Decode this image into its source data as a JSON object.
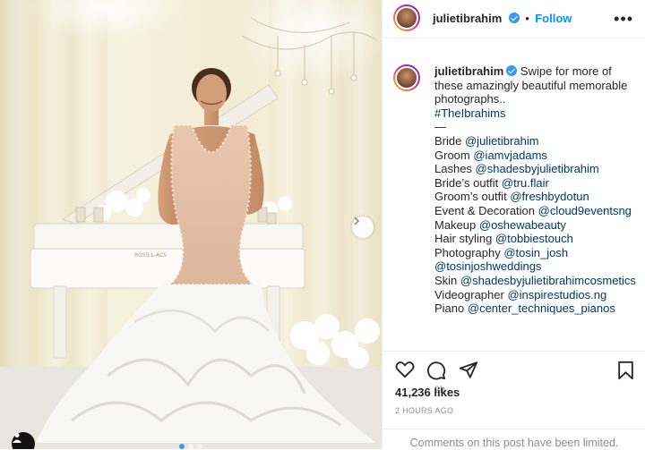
{
  "post": {
    "username": "julietibrahim",
    "follow_label": "Follow",
    "more_label": "•••",
    "caption": {
      "intro": "Swipe for more of these amazingly beautiful memorable photographs..",
      "hashtag": "#TheIbrahims",
      "dash": "—",
      "credits": [
        {
          "role": "Bride",
          "handle": "@julietibrahim"
        },
        {
          "role": "Groom",
          "handle": "@iamvjadams"
        },
        {
          "role": "Lashes",
          "handle": "@shadesbyjulietibrahim"
        },
        {
          "role": "Bride’s outfit",
          "handle": "@tru.flair"
        },
        {
          "role": "Groom’s outfit",
          "handle": "@freshbydotun"
        },
        {
          "role": "Event & Decoration",
          "handle": "@cloud9eventsng"
        },
        {
          "role": "Makeup",
          "handle": "@oshewabeauty"
        },
        {
          "role": "Hair styling",
          "handle": "@tobbiestouch"
        },
        {
          "role": "Photography",
          "handle": "@tosin_josh"
        },
        {
          "role": "",
          "handle": "@tosinjoshweddings"
        },
        {
          "role": "Skin",
          "handle": "@shadesbyjulietibrahimcosmetics"
        },
        {
          "role": "Videographer",
          "handle": "@inspirestudios.ng"
        },
        {
          "role": "Piano",
          "handle": "@center_techniques_pianos"
        }
      ]
    },
    "time_ago": "2h",
    "likes": "41,236 likes",
    "date": "2 HOURS AGO",
    "comments_limited": "Comments on this post have been limited.",
    "piano_brand": "ROSS-L-ACS"
  },
  "colors": {
    "accent": "#0095f6",
    "verified": "#3897f0",
    "link": "#00376b",
    "muted": "#8e8e8e"
  },
  "icons": [
    "verified-badge-icon",
    "more-options-icon",
    "heart-icon",
    "comment-icon",
    "share-icon",
    "bookmark-icon",
    "chevron-right-icon",
    "user-tag-icon"
  ]
}
